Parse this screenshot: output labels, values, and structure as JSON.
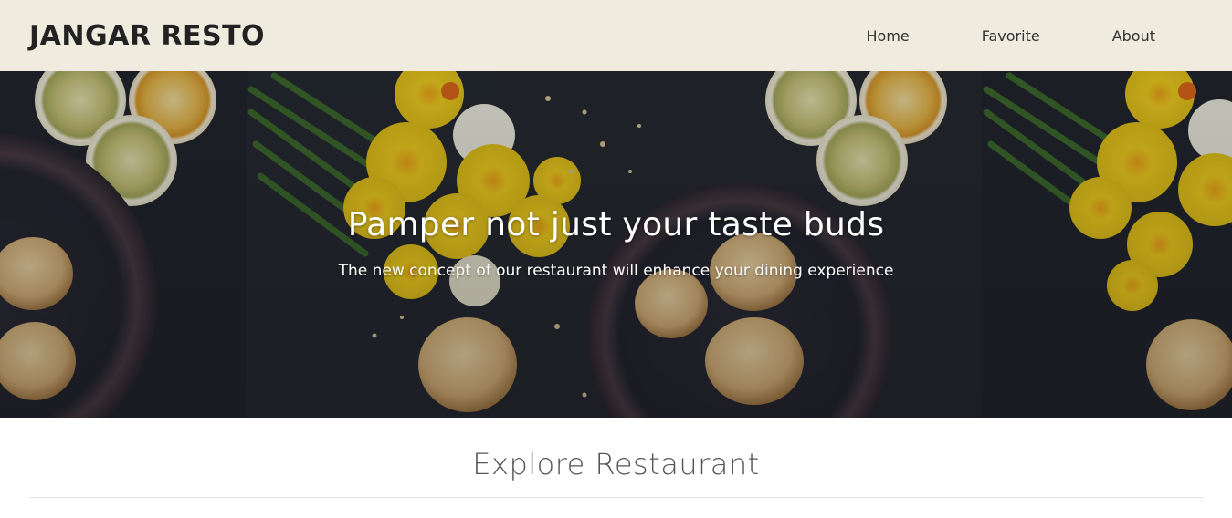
{
  "header": {
    "brand": "JANGAR RESTO",
    "nav": [
      {
        "label": "Home"
      },
      {
        "label": "Favorite"
      },
      {
        "label": "About"
      }
    ],
    "background": "#efebdf"
  },
  "hero": {
    "title": "Pamper not just your taste buds",
    "subtitle": "The new concept of our restaurant will enhance your dining experience",
    "image": "hero-food-photo"
  },
  "explore": {
    "title": "Explore Restaurant"
  }
}
